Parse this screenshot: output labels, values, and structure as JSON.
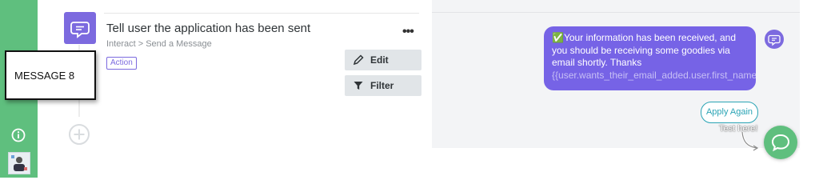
{
  "sidebar": {
    "info_icon": "info-icon",
    "avatar_icon": "avatar"
  },
  "overlay": {
    "label": "MESSAGE 8"
  },
  "step": {
    "title": "Tell user the application has been sent",
    "breadcrumb": "Interact > Send a Message",
    "badge": "Action",
    "more_icon": "more-dots-icon",
    "icon": "speech-bubble-icon",
    "buttons": {
      "edit": "Edit",
      "filter": "Filter"
    },
    "add_icon": "plus-circle-icon"
  },
  "preview": {
    "emoji": "✅",
    "message": "Your information has been received, and you should be receiving some goodies via email shortly. Thanks",
    "variable": "{{user.wants_their_email_added.user.first_name}}!",
    "apply_button": "Apply Again",
    "test_hint": "Test here!",
    "chat_icon": "chat-bubble-icon",
    "colors": {
      "bubble": "#7663e6",
      "accent": "#5fbf7e",
      "button_border": "#2aa4b5"
    }
  }
}
